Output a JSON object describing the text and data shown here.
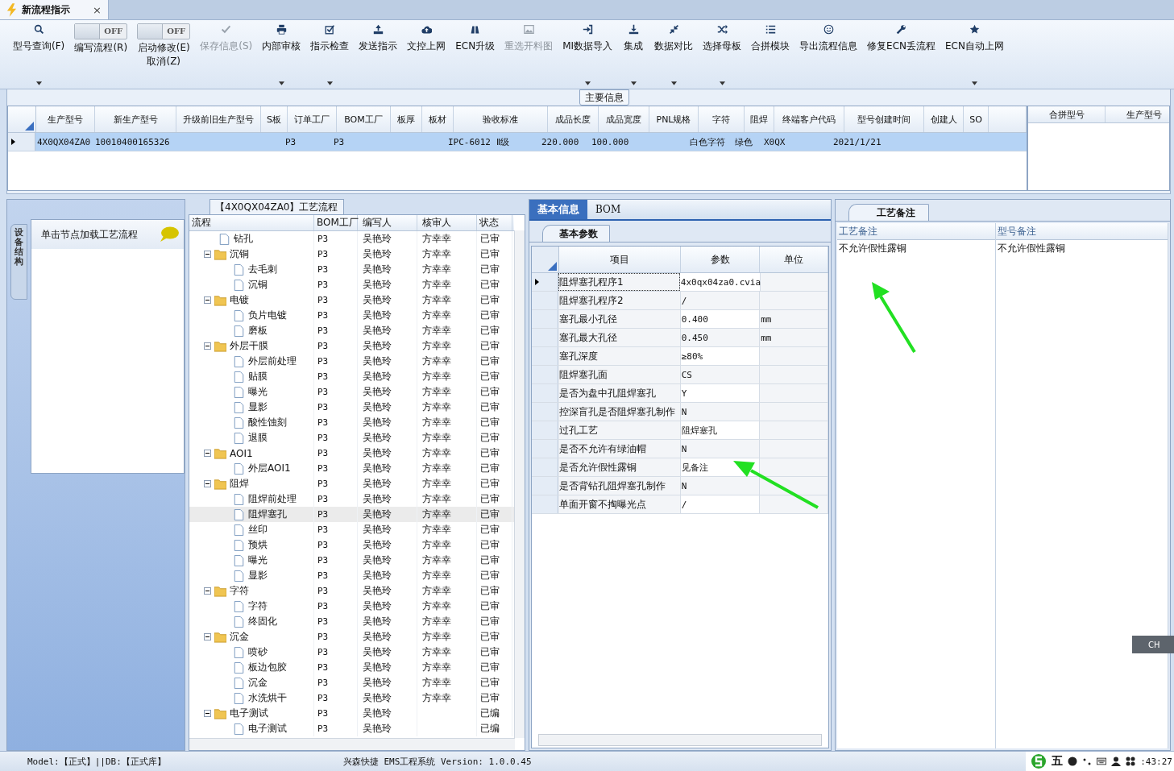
{
  "doc_tab": {
    "title": "新流程指示",
    "close": "×"
  },
  "toolbar": [
    {
      "kind": "button",
      "label": "型号查询(F)",
      "dropdown": true,
      "disabled": false
    },
    {
      "kind": "toggle",
      "switch_text": "OFF",
      "on": false,
      "label": "编写流程(R)",
      "dropdown": false,
      "disabled": false
    },
    {
      "kind": "toggle",
      "switch_text": "OFF",
      "on": false,
      "label": "启动修改(E)\n取消(Z)",
      "dropdown": false,
      "disabled": false
    },
    {
      "kind": "button",
      "label": "保存信息(S)",
      "dropdown": false,
      "disabled": true
    },
    {
      "kind": "button",
      "label": "内部审核",
      "dropdown": true,
      "disabled": false
    },
    {
      "kind": "button",
      "label": "指示检查",
      "dropdown": true,
      "disabled": false
    },
    {
      "kind": "button",
      "label": "发送指示",
      "dropdown": false,
      "disabled": false
    },
    {
      "kind": "button",
      "label": "文控上网",
      "dropdown": false,
      "disabled": false
    },
    {
      "kind": "button",
      "label": "ECN升级",
      "dropdown": false,
      "disabled": false
    },
    {
      "kind": "button",
      "label": "重选开料图",
      "dropdown": false,
      "disabled": true
    },
    {
      "kind": "button",
      "label": "MI数据导入",
      "dropdown": true,
      "disabled": false
    },
    {
      "kind": "button",
      "label": "集成",
      "dropdown": true,
      "disabled": false
    },
    {
      "kind": "button",
      "label": "数据对比",
      "dropdown": true,
      "disabled": false
    },
    {
      "kind": "button",
      "label": "选择母板",
      "dropdown": true,
      "disabled": false
    },
    {
      "kind": "button",
      "label": "合拼模块",
      "dropdown": false,
      "disabled": false
    },
    {
      "kind": "button",
      "label": "导出流程信息",
      "dropdown": false,
      "disabled": false
    },
    {
      "kind": "button",
      "label": "修复ECN丢流程",
      "dropdown": false,
      "disabled": false
    },
    {
      "kind": "button",
      "label": "ECN自动上网",
      "dropdown": true,
      "disabled": false
    }
  ],
  "main_info": {
    "title": "主要信息",
    "columns": [
      "生产型号",
      "新生产型号",
      "升级前旧生产型号",
      "S板",
      "订单工厂",
      "BOM工厂",
      "板厚",
      "板材",
      "验收标准",
      "成品长度",
      "成品宽度",
      "PNL规格",
      "字符",
      "阻焊",
      "终端客户代码",
      "型号创建时间",
      "创建人",
      "SO"
    ],
    "rows": [
      {
        "selected": true,
        "cells": [
          "4X0QX04ZA0",
          "10010400165326",
          "",
          "",
          "P3",
          "P3",
          "",
          "",
          "IPC-6012 Ⅱ级",
          "220.000",
          "100.000",
          "",
          "白色字符",
          "绿色",
          "X0QX",
          "2021/1/21",
          "",
          ""
        ]
      }
    ],
    "side_columns": [
      "合拼型号",
      "生产型号"
    ]
  },
  "left_panel": {
    "vertical_tab": "设备结构",
    "items": [
      {
        "label": "单击节点加载工艺流程"
      }
    ]
  },
  "flow": {
    "title": "【4X0QX04ZA0】工艺流程",
    "columns": [
      "流程",
      "BOM工厂",
      "编写人",
      "核审人",
      "状态"
    ],
    "nodes": [
      {
        "name": "钻孔",
        "factory": "P3",
        "writer": "吴艳玲",
        "reviewer": "方幸幸",
        "status": "已审",
        "selected": false
      },
      {
        "name": "沉铜",
        "factory": "P3",
        "writer": "吴艳玲",
        "reviewer": "方幸幸",
        "status": "已审",
        "selected": false,
        "expanded": true,
        "children": [
          {
            "name": "去毛刺",
            "factory": "P3",
            "writer": "吴艳玲",
            "reviewer": "方幸幸",
            "status": "已审",
            "selected": false
          },
          {
            "name": "沉铜",
            "factory": "P3",
            "writer": "吴艳玲",
            "reviewer": "方幸幸",
            "status": "已审",
            "selected": false
          }
        ]
      },
      {
        "name": "电镀",
        "factory": "P3",
        "writer": "吴艳玲",
        "reviewer": "方幸幸",
        "status": "已审",
        "selected": false,
        "expanded": true,
        "children": [
          {
            "name": "负片电镀",
            "factory": "P3",
            "writer": "吴艳玲",
            "reviewer": "方幸幸",
            "status": "已审",
            "selected": false
          },
          {
            "name": "磨板",
            "factory": "P3",
            "writer": "吴艳玲",
            "reviewer": "方幸幸",
            "status": "已审",
            "selected": false
          }
        ]
      },
      {
        "name": "外层干膜",
        "factory": "P3",
        "writer": "吴艳玲",
        "reviewer": "方幸幸",
        "status": "已审",
        "selected": false,
        "expanded": true,
        "children": [
          {
            "name": "外层前处理",
            "factory": "P3",
            "writer": "吴艳玲",
            "reviewer": "方幸幸",
            "status": "已审",
            "selected": false
          },
          {
            "name": "贴膜",
            "factory": "P3",
            "writer": "吴艳玲",
            "reviewer": "方幸幸",
            "status": "已审",
            "selected": false
          },
          {
            "name": "曝光",
            "factory": "P3",
            "writer": "吴艳玲",
            "reviewer": "方幸幸",
            "status": "已审",
            "selected": false
          },
          {
            "name": "显影",
            "factory": "P3",
            "writer": "吴艳玲",
            "reviewer": "方幸幸",
            "status": "已审",
            "selected": false
          },
          {
            "name": "酸性蚀刻",
            "factory": "P3",
            "writer": "吴艳玲",
            "reviewer": "方幸幸",
            "status": "已审",
            "selected": false
          },
          {
            "name": "退膜",
            "factory": "P3",
            "writer": "吴艳玲",
            "reviewer": "方幸幸",
            "status": "已审",
            "selected": false
          }
        ]
      },
      {
        "name": "AOI1",
        "factory": "P3",
        "writer": "吴艳玲",
        "reviewer": "方幸幸",
        "status": "已审",
        "selected": false,
        "expanded": true,
        "children": [
          {
            "name": "外层AOI1",
            "factory": "P3",
            "writer": "吴艳玲",
            "reviewer": "方幸幸",
            "status": "已审",
            "selected": false
          }
        ]
      },
      {
        "name": "阻焊",
        "factory": "P3",
        "writer": "吴艳玲",
        "reviewer": "方幸幸",
        "status": "已审",
        "selected": false,
        "expanded": true,
        "children": [
          {
            "name": "阻焊前处理",
            "factory": "P3",
            "writer": "吴艳玲",
            "reviewer": "方幸幸",
            "status": "已审",
            "selected": false
          },
          {
            "name": "阻焊塞孔",
            "factory": "P3",
            "writer": "吴艳玲",
            "reviewer": "方幸幸",
            "status": "已审",
            "selected": true
          },
          {
            "name": "丝印",
            "factory": "P3",
            "writer": "吴艳玲",
            "reviewer": "方幸幸",
            "status": "已审",
            "selected": false
          },
          {
            "name": "预烘",
            "factory": "P3",
            "writer": "吴艳玲",
            "reviewer": "方幸幸",
            "status": "已审",
            "selected": false
          },
          {
            "name": "曝光",
            "factory": "P3",
            "writer": "吴艳玲",
            "reviewer": "方幸幸",
            "status": "已审",
            "selected": false
          },
          {
            "name": "显影",
            "factory": "P3",
            "writer": "吴艳玲",
            "reviewer": "方幸幸",
            "status": "已审",
            "selected": false
          }
        ]
      },
      {
        "name": "字符",
        "factory": "P3",
        "writer": "吴艳玲",
        "reviewer": "方幸幸",
        "status": "已审",
        "selected": false,
        "expanded": true,
        "children": [
          {
            "name": "字符",
            "factory": "P3",
            "writer": "吴艳玲",
            "reviewer": "方幸幸",
            "status": "已审",
            "selected": false
          },
          {
            "name": "终固化",
            "factory": "P3",
            "writer": "吴艳玲",
            "reviewer": "方幸幸",
            "status": "已审",
            "selected": false
          }
        ]
      },
      {
        "name": "沉金",
        "factory": "P3",
        "writer": "吴艳玲",
        "reviewer": "方幸幸",
        "status": "已审",
        "selected": false,
        "expanded": true,
        "children": [
          {
            "name": "喷砂",
            "factory": "P3",
            "writer": "吴艳玲",
            "reviewer": "方幸幸",
            "status": "已审",
            "selected": false
          },
          {
            "name": "板边包胶",
            "factory": "P3",
            "writer": "吴艳玲",
            "reviewer": "方幸幸",
            "status": "已审",
            "selected": false
          },
          {
            "name": "沉金",
            "factory": "P3",
            "writer": "吴艳玲",
            "reviewer": "方幸幸",
            "status": "已审",
            "selected": false
          },
          {
            "name": "水洗烘干",
            "factory": "P3",
            "writer": "吴艳玲",
            "reviewer": "方幸幸",
            "status": "已审",
            "selected": false
          }
        ]
      },
      {
        "name": "电子测试",
        "factory": "P3",
        "writer": "吴艳玲",
        "status": "已编",
        "selected": false,
        "expanded": true,
        "children": [
          {
            "name": "电子测试",
            "factory": "P3",
            "writer": "吴艳玲",
            "status": "已编",
            "selected": false
          }
        ]
      }
    ]
  },
  "detail_tabs": [
    {
      "label": "基本信息",
      "selected": true
    },
    {
      "label": "BOM",
      "selected": false
    }
  ],
  "params": {
    "tab": "基本参数",
    "columns": [
      "项目",
      "参数",
      "单位"
    ],
    "rows": [
      {
        "item": "阻焊塞孔程序1",
        "value": "4x0qx04za0.cvia",
        "unit": "",
        "current": true
      },
      {
        "item": "阻焊塞孔程序2",
        "value": "/",
        "unit": "",
        "current": false
      },
      {
        "item": "塞孔最小孔径",
        "value": "0.400",
        "unit": "mm",
        "current": false
      },
      {
        "item": "塞孔最大孔径",
        "value": "0.450",
        "unit": "mm",
        "current": false
      },
      {
        "item": "塞孔深度",
        "value": "≥80%",
        "unit": "",
        "current": false
      },
      {
        "item": "阻焊塞孔面",
        "value": "CS",
        "unit": "",
        "current": false
      },
      {
        "item": "是否为盘中孔阻焊塞孔",
        "value": "Y",
        "unit": "",
        "current": false
      },
      {
        "item": "控深盲孔是否阻焊塞孔制作",
        "value": "N",
        "unit": "",
        "current": false
      },
      {
        "item": "过孔工艺",
        "value": "阻焊塞孔",
        "unit": "",
        "current": false
      },
      {
        "item": "是否不允许有绿油帽",
        "value": "N",
        "unit": "",
        "current": false
      },
      {
        "item": "是否允许假性露铜",
        "value": "见备注",
        "unit": "",
        "current": false
      },
      {
        "item": "是否背钻孔阻焊塞孔制作",
        "value": "N",
        "unit": "",
        "current": false
      },
      {
        "item": "单面开窗不掏曝光点",
        "value": "/",
        "unit": "",
        "current": false
      }
    ]
  },
  "remarks": {
    "tab": "工艺备注",
    "columns": [
      "工艺备注",
      "型号备注"
    ],
    "values": [
      "不允许假性露铜",
      "不允许假性露铜"
    ]
  },
  "ime_float": {
    "label": "CH"
  },
  "status_bar": {
    "left": "Model:【正式】||DB:【正式库】",
    "center": "兴森快捷  EMS工程系统  Version: 1.0.0.45",
    "ime_mode": "五",
    "time": ":43:27"
  }
}
